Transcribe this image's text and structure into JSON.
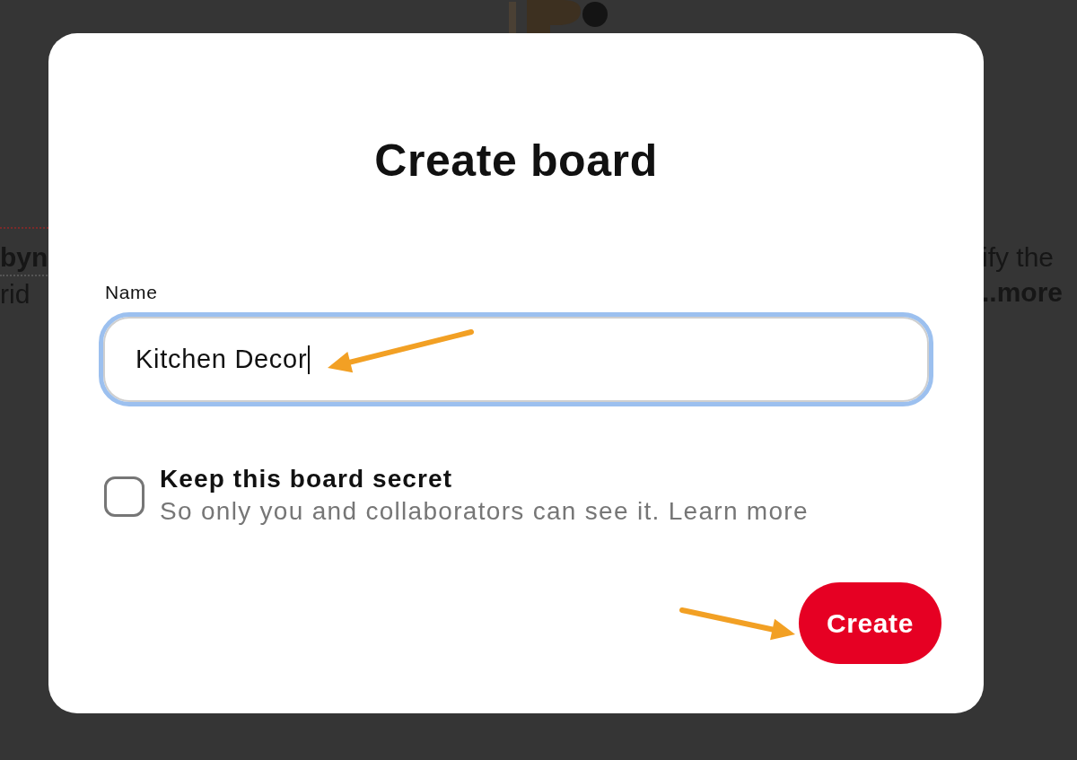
{
  "background": {
    "left_lines": [
      {
        "text": "byn",
        "kind": "link"
      },
      {
        "text": "rid",
        "kind": "text"
      }
    ],
    "right_lines": [
      {
        "text": "ify the",
        "kind": "text"
      },
      {
        "text": "..more",
        "kind": "link"
      }
    ]
  },
  "dialog": {
    "title": "Create board",
    "name_field": {
      "label": "Name",
      "value": "Kitchen Decor",
      "focused": true
    },
    "secret_option": {
      "label": "Keep this board secret",
      "description": "So only you and collaborators can see it. Learn more",
      "checked": false
    },
    "buttons": [
      {
        "label": "Create",
        "kind": "primary"
      }
    ]
  }
}
